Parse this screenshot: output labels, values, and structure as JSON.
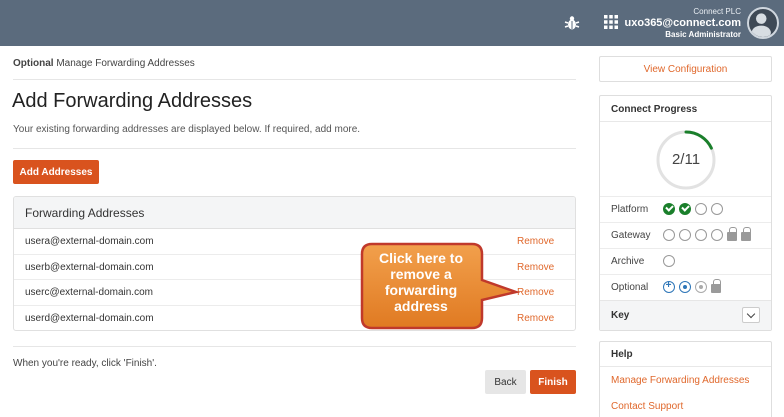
{
  "header": {
    "company": "Connect PLC",
    "email": "uxo365@connect.com",
    "role": "Basic Administrator"
  },
  "breadcrumb": {
    "bold": "Optional",
    "rest": " Manage Forwarding Addresses"
  },
  "page": {
    "title": "Add Forwarding Addresses",
    "description": "Your existing forwarding addresses are displayed below. If required, add more.",
    "add_button": "Add Addresses"
  },
  "addresses": {
    "heading": "Forwarding Addresses",
    "remove_label": "Remove",
    "items": [
      "usera@external-domain.com",
      "userb@external-domain.com",
      "userc@external-domain.com",
      "userd@external-domain.com"
    ]
  },
  "footer": {
    "ready_text": "When you're ready, click 'Finish'.",
    "back_label": "Back",
    "finish_label": "Finish"
  },
  "callout": {
    "text": "Click here to remove a forwarding address"
  },
  "sidebar": {
    "view_config": "View Configuration",
    "progress_title": "Connect Progress",
    "progress_label": "2/11",
    "progress_fraction": 0.18,
    "rows": [
      {
        "label": "Platform"
      },
      {
        "label": "Gateway"
      },
      {
        "label": "Archive"
      },
      {
        "label": "Optional"
      }
    ],
    "key_label": "Key",
    "help_title": "Help",
    "help_links": [
      "Manage Forwarding Addresses",
      "Contact Support"
    ]
  },
  "colors": {
    "topbar": "#5b6b7d",
    "accent": "#d9531e",
    "link": "#e0682c",
    "done": "#1a7f2b",
    "callout": "#e8862f"
  },
  "icons": {
    "bug": "bug-icon",
    "apps": "apps-grid-icon",
    "avatar": "user-avatar-icon",
    "lock": "lock-icon",
    "chevron": "chevron-down-icon"
  }
}
